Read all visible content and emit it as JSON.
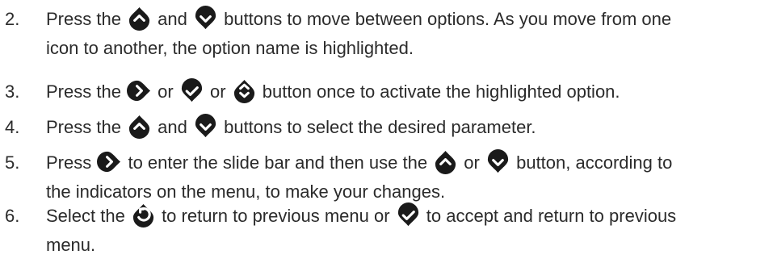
{
  "steps": [
    {
      "number": "2.",
      "lines": [
        [
          {
            "text": "Press the "
          },
          {
            "icon": "up-arrow-icon"
          },
          {
            "text": " and "
          },
          {
            "icon": "down-arrow-icon"
          },
          {
            "text": " buttons to move between options. As you move from one"
          }
        ],
        [
          {
            "text": "icon to another, the option name is highlighted."
          }
        ]
      ]
    },
    {
      "number": "3.",
      "lines": [
        [
          {
            "text": "Press the "
          },
          {
            "icon": "right-arrow-icon"
          },
          {
            "text": " or "
          },
          {
            "icon": "check-icon"
          },
          {
            "text": " or "
          },
          {
            "icon": "up-down-arrow-icon"
          },
          {
            "text": " button once to activate the highlighted option."
          }
        ]
      ]
    },
    {
      "number": "4.",
      "lines": [
        [
          {
            "text": "Press the "
          },
          {
            "icon": "up-arrow-icon"
          },
          {
            "text": " and "
          },
          {
            "icon": "down-arrow-icon"
          },
          {
            "text": " buttons to select the desired parameter."
          }
        ]
      ]
    },
    {
      "number": "5.",
      "lines": [
        [
          {
            "text": "Press "
          },
          {
            "icon": "right-arrow-icon"
          },
          {
            "text": " to enter the slide bar and then use the "
          },
          {
            "icon": "up-arrow-icon"
          },
          {
            "text": " or "
          },
          {
            "icon": "down-arrow-icon"
          },
          {
            "text": " button, according to"
          }
        ],
        [
          {
            "text": "the indicators on the menu, to make your changes."
          }
        ]
      ]
    },
    {
      "number": "6.",
      "lines": [
        [
          {
            "text": "Select the "
          },
          {
            "icon": "back-icon"
          },
          {
            "text": " to return to previous menu or "
          },
          {
            "icon": "check-icon"
          },
          {
            "text": " to accept and return to previous"
          }
        ],
        [
          {
            "text": "menu."
          }
        ]
      ]
    }
  ],
  "colors": {
    "text": "#2b2b2b",
    "icon_fill": "#1a1a1a",
    "icon_glyph": "#ffffff"
  }
}
